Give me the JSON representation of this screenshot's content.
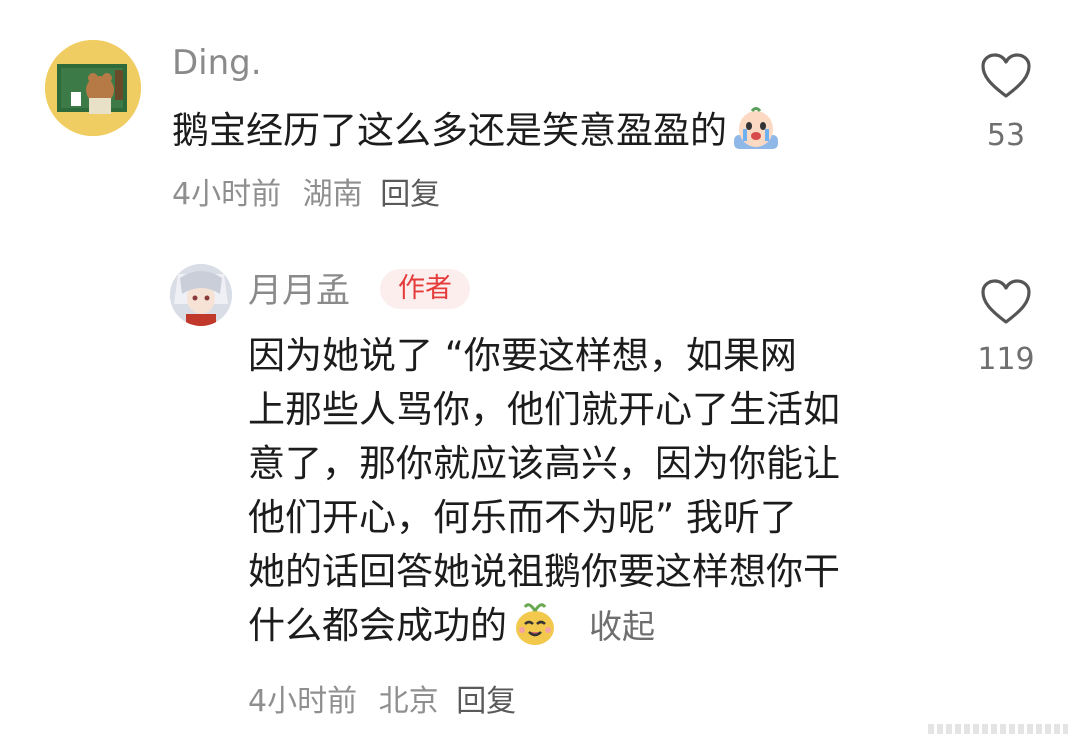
{
  "comments": [
    {
      "username": "Ding.",
      "text": "鹅宝经历了这么多还是笑意盈盈的",
      "emoji": "crying-egg-emoji",
      "time": "4小时前",
      "location": "湖南",
      "reply_label": "回复",
      "likes": "53"
    }
  ],
  "reply": {
    "username": "月月孟",
    "badge": "作者",
    "lines": [
      "因为她说了 “你要这样想，如果网",
      "上那些人骂你，他们就开心了生活如",
      "意了，那你就应该高兴，因为你能让",
      "他们开心，何乐而不为呢” 我听了",
      "她的话回答她说祖鹅你要这样想你干",
      "什么都会成功的"
    ],
    "emoji": "happy-sprout-emoji",
    "collapse_label": "收起",
    "time": "4小时前",
    "location": "北京",
    "reply_label": "回复",
    "likes": "119"
  },
  "icons": {
    "like": "heart-outline-icon"
  },
  "colors": {
    "author_badge_bg": "#fdeeee",
    "author_badge_text": "#e43b3b",
    "meta_text": "#8f8f8f"
  }
}
